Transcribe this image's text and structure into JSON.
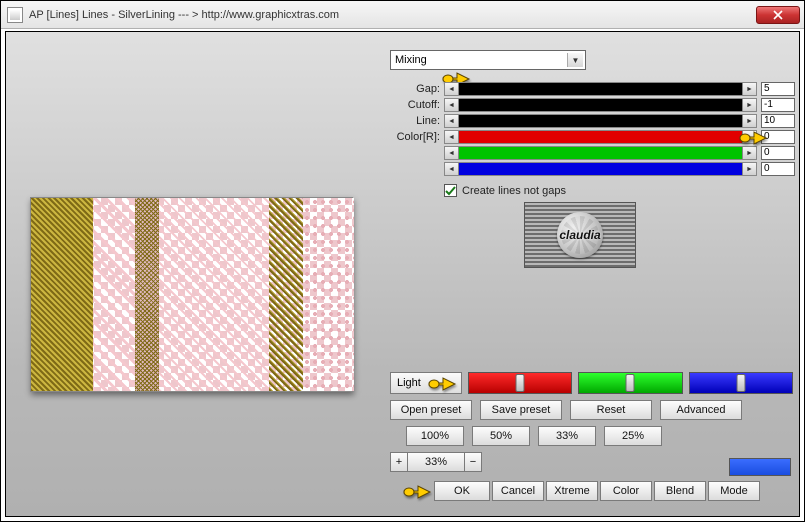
{
  "window": {
    "title": "AP [Lines]  Lines - SilverLining   --- > http://www.graphicxtras.com"
  },
  "dropdown": {
    "mixing": "Mixing"
  },
  "sliders": {
    "gap": {
      "label": "Gap:",
      "value": "5"
    },
    "cutoff": {
      "label": "Cutoff:",
      "value": "-1"
    },
    "line": {
      "label": "Line:",
      "value": "10"
    },
    "colorR": {
      "label": "Color[R]:",
      "value": "0"
    },
    "colorG": {
      "label": "",
      "value": "0"
    },
    "colorB": {
      "label": "",
      "value": "0"
    }
  },
  "checkbox": {
    "create_lines": {
      "label": "Create lines not gaps",
      "checked": true
    }
  },
  "logo": {
    "text": "claudia"
  },
  "light_button": "Light",
  "preset_row": {
    "open": "Open preset",
    "save": "Save preset",
    "reset": "Reset",
    "advanced": "Advanced"
  },
  "pct_row": {
    "p100": "100%",
    "p50": "50%",
    "p33": "33%",
    "p25": "25%"
  },
  "zoom": {
    "plus": "+",
    "value": "33%",
    "minus": "−"
  },
  "actions": {
    "ok": "OK",
    "cancel": "Cancel",
    "xtreme": "Xtreme",
    "color": "Color",
    "blend": "Blend",
    "mode": "Mode"
  }
}
